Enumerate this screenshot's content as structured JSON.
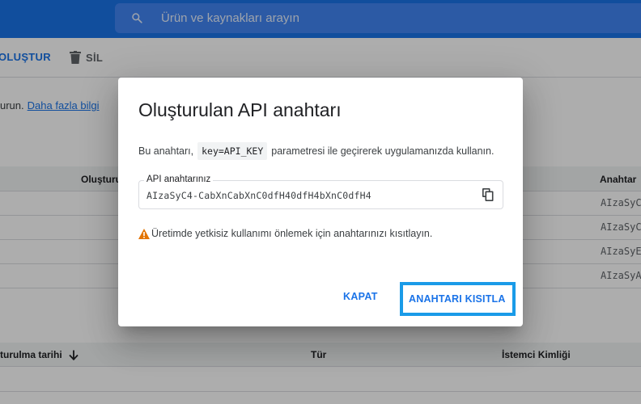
{
  "header": {
    "search_placeholder": "Ürün ve kaynakları arayın"
  },
  "toolbar": {
    "create_label": "OLUŞTUR",
    "delete_label": "SİL"
  },
  "info": {
    "text": "urun.",
    "link": "Daha fazla bilgi"
  },
  "keys_table": {
    "headers": {
      "created": "Oluşturu",
      "key": "Anahtar"
    },
    "rows": [
      "AIzaSyC",
      "AIzaSyC",
      "AIzaSyE",
      "AIzaSyA"
    ]
  },
  "clients_table": {
    "headers": {
      "created": "turulma tarihi",
      "type": "Tür",
      "client_id": "İstemci Kimliği"
    }
  },
  "dialog": {
    "title": "Oluşturulan API anahtarı",
    "desc_prefix": "Bu anahtarı,",
    "desc_code": "key=API_KEY",
    "desc_suffix": "parametresi ile geçirerek uygulamanızda kullanın.",
    "field_label": "API anahtarınız",
    "api_key": "AIzaSyC4-CabXnCabXnC0dfH40dfH4bXnC0dfH4",
    "warning": "Üretimde yetkisiz kullanımı önlemek için anahtarınızı kısıtlayın.",
    "close_button": "KAPAT",
    "restrict_button": "ANAHTARI KISITLA"
  },
  "colors": {
    "brand_blue": "#1a73e8",
    "highlight_border": "#1a9be8",
    "warning": "#e37400"
  },
  "icons": [
    "search-icon",
    "trash-icon",
    "arrow-down-icon",
    "copy-icon",
    "warning-icon"
  ]
}
